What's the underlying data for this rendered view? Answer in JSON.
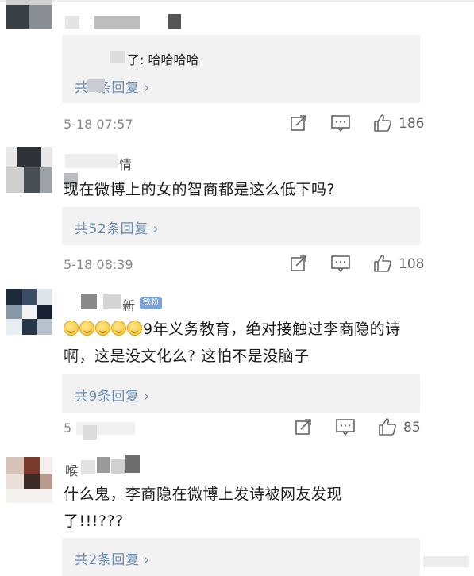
{
  "comments": [
    {
      "id": "c1",
      "reply_preview": "了: 哈哈哈哈",
      "reply_link": "共3条回复",
      "timestamp": "5-18 07:57",
      "likes": "186"
    },
    {
      "id": "c2",
      "username_fragment": "情",
      "text": "现在微博上的女的智商都是这么低下吗?",
      "reply_link": "共52条回复",
      "timestamp": "5-18 08:39",
      "likes": "108"
    },
    {
      "id": "c3",
      "username_fragment": "新",
      "badge": "铁粉",
      "text_line1": "9年义务教育，绝对接触过李商隐的诗",
      "text_line2": "啊，这是没文化么? 这怕不是没脑子",
      "reply_link": "共9条回复",
      "timestamp": "5",
      "likes": "85"
    },
    {
      "id": "c4",
      "username_fragment": "喉",
      "text_line1": "什么鬼，李商隐在微博上发诗被网友发现",
      "text_line2": "了!!!???",
      "reply_link": "共2条回复"
    }
  ],
  "ui": {
    "chevron": "›",
    "icons": [
      "share-icon",
      "comment-icon",
      "like-icon"
    ],
    "link_color": "#6b8cb3",
    "reply_bg": "#f2f2f2",
    "meta_color": "#888888"
  }
}
